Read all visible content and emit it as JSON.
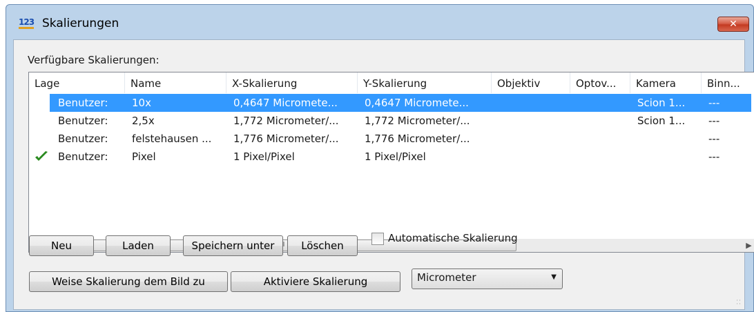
{
  "window": {
    "title": "Skalierungen",
    "app_icon_text": "123",
    "close_label": "✕"
  },
  "section_label": "Verfügbare Skalierungen:",
  "table": {
    "columns": [
      "Lage",
      "Name",
      "X-Skalierung",
      "Y-Skalierung",
      "Objektiv",
      "Optov...",
      "Kamera",
      "Binn..."
    ],
    "rows": [
      {
        "lage": "Benutzer:",
        "name": "10x",
        "x": "0,4647 Micromete...",
        "y": "0,4647 Micromete...",
        "objektiv": "",
        "optov": "",
        "kamera": "Scion 1...",
        "binn": "---",
        "selected": true,
        "active": false
      },
      {
        "lage": "Benutzer:",
        "name": "2,5x",
        "x": "1,772 Micrometer/...",
        "y": "1,772 Micrometer/...",
        "objektiv": "",
        "optov": "",
        "kamera": "Scion 1...",
        "binn": "---",
        "selected": false,
        "active": false
      },
      {
        "lage": "Benutzer:",
        "name": "felstehausen ...",
        "x": "1,776 Micrometer/...",
        "y": "1,776 Micrometer/...",
        "objektiv": "",
        "optov": "",
        "kamera": "",
        "binn": "---",
        "selected": false,
        "active": false
      },
      {
        "lage": "Benutzer:",
        "name": "Pixel",
        "x": "1 Pixel/Pixel",
        "y": "1 Pixel/Pixel",
        "objektiv": "",
        "optov": "",
        "kamera": "",
        "binn": "---",
        "selected": false,
        "active": true
      }
    ],
    "scrollbar_thumb_grip": "III",
    "selection_color": "#3399ff",
    "active_check_color": "#2a8a1f"
  },
  "buttons": {
    "neu": "Neu",
    "laden": "Laden",
    "speichern_unter": "Speichern unter",
    "loeschen": "Löschen",
    "weise_zu": "Weise Skalierung dem Bild zu",
    "aktiviere": "Aktiviere Skalierung"
  },
  "auto_scaling": {
    "label": "Automatische Skalierung",
    "checked": false
  },
  "unit_select": {
    "value": "Micrometer"
  }
}
